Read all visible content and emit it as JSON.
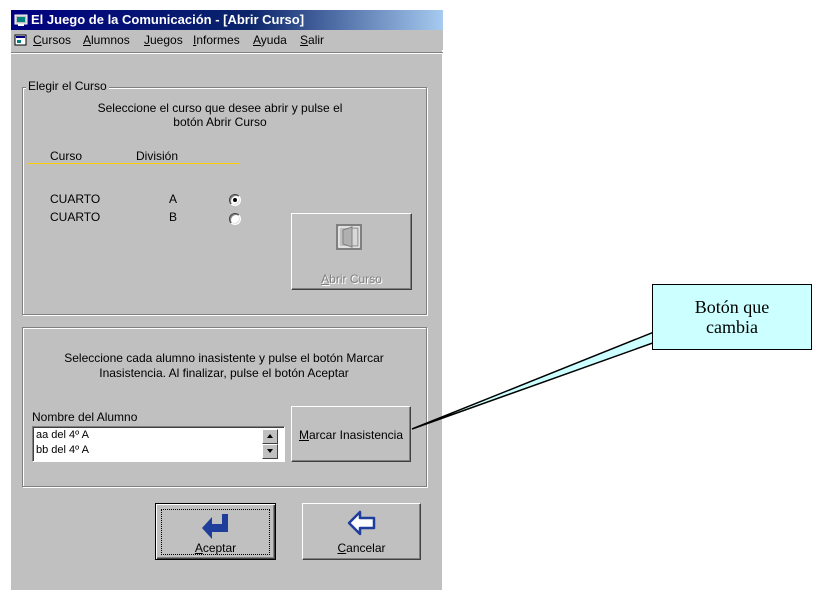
{
  "window": {
    "title": "El Juego de la Comunicación - [Abrir Curso]"
  },
  "menu": {
    "items": [
      "Cursos",
      "Alumnos",
      "Juegos",
      "Informes",
      "Ayuda",
      "Salir"
    ]
  },
  "course_group": {
    "legend": "Elegir el Curso",
    "instructions_line1": "Seleccione el curso que desee abrir y pulse el",
    "instructions_line2": "botón Abrir Curso",
    "col_curso": "Curso",
    "col_division": "División",
    "rows": [
      {
        "curso": "CUARTO",
        "division": "A",
        "selected": true
      },
      {
        "curso": "CUARTO",
        "division": "B",
        "selected": false
      }
    ],
    "open_button_label": "Abrir Curso",
    "open_button_enabled": false
  },
  "attendance_group": {
    "instructions_line1": "Seleccione cada alumno inasistente y pulse el botón Marcar",
    "instructions_line2": "Inasistencia. Al finalizar, pulse el botón Aceptar",
    "list_label": "Nombre del Alumno",
    "students": [
      "aa del 4º A",
      "bb del 4º A"
    ],
    "mark_button_label": "Marcar Inasistencia"
  },
  "footer": {
    "accept_label": "Aceptar",
    "cancel_label": "Cancelar"
  },
  "callout": {
    "line1": "Botón que",
    "line2": "cambia"
  },
  "colors": {
    "title_bar": "#000080",
    "window_face": "#c0c0c0",
    "header_rule": "#ffcc00",
    "callout_fill": "#ccffff",
    "accept_arrow": "#1f3e9c",
    "cancel_arrow": "#1f3e9c"
  }
}
